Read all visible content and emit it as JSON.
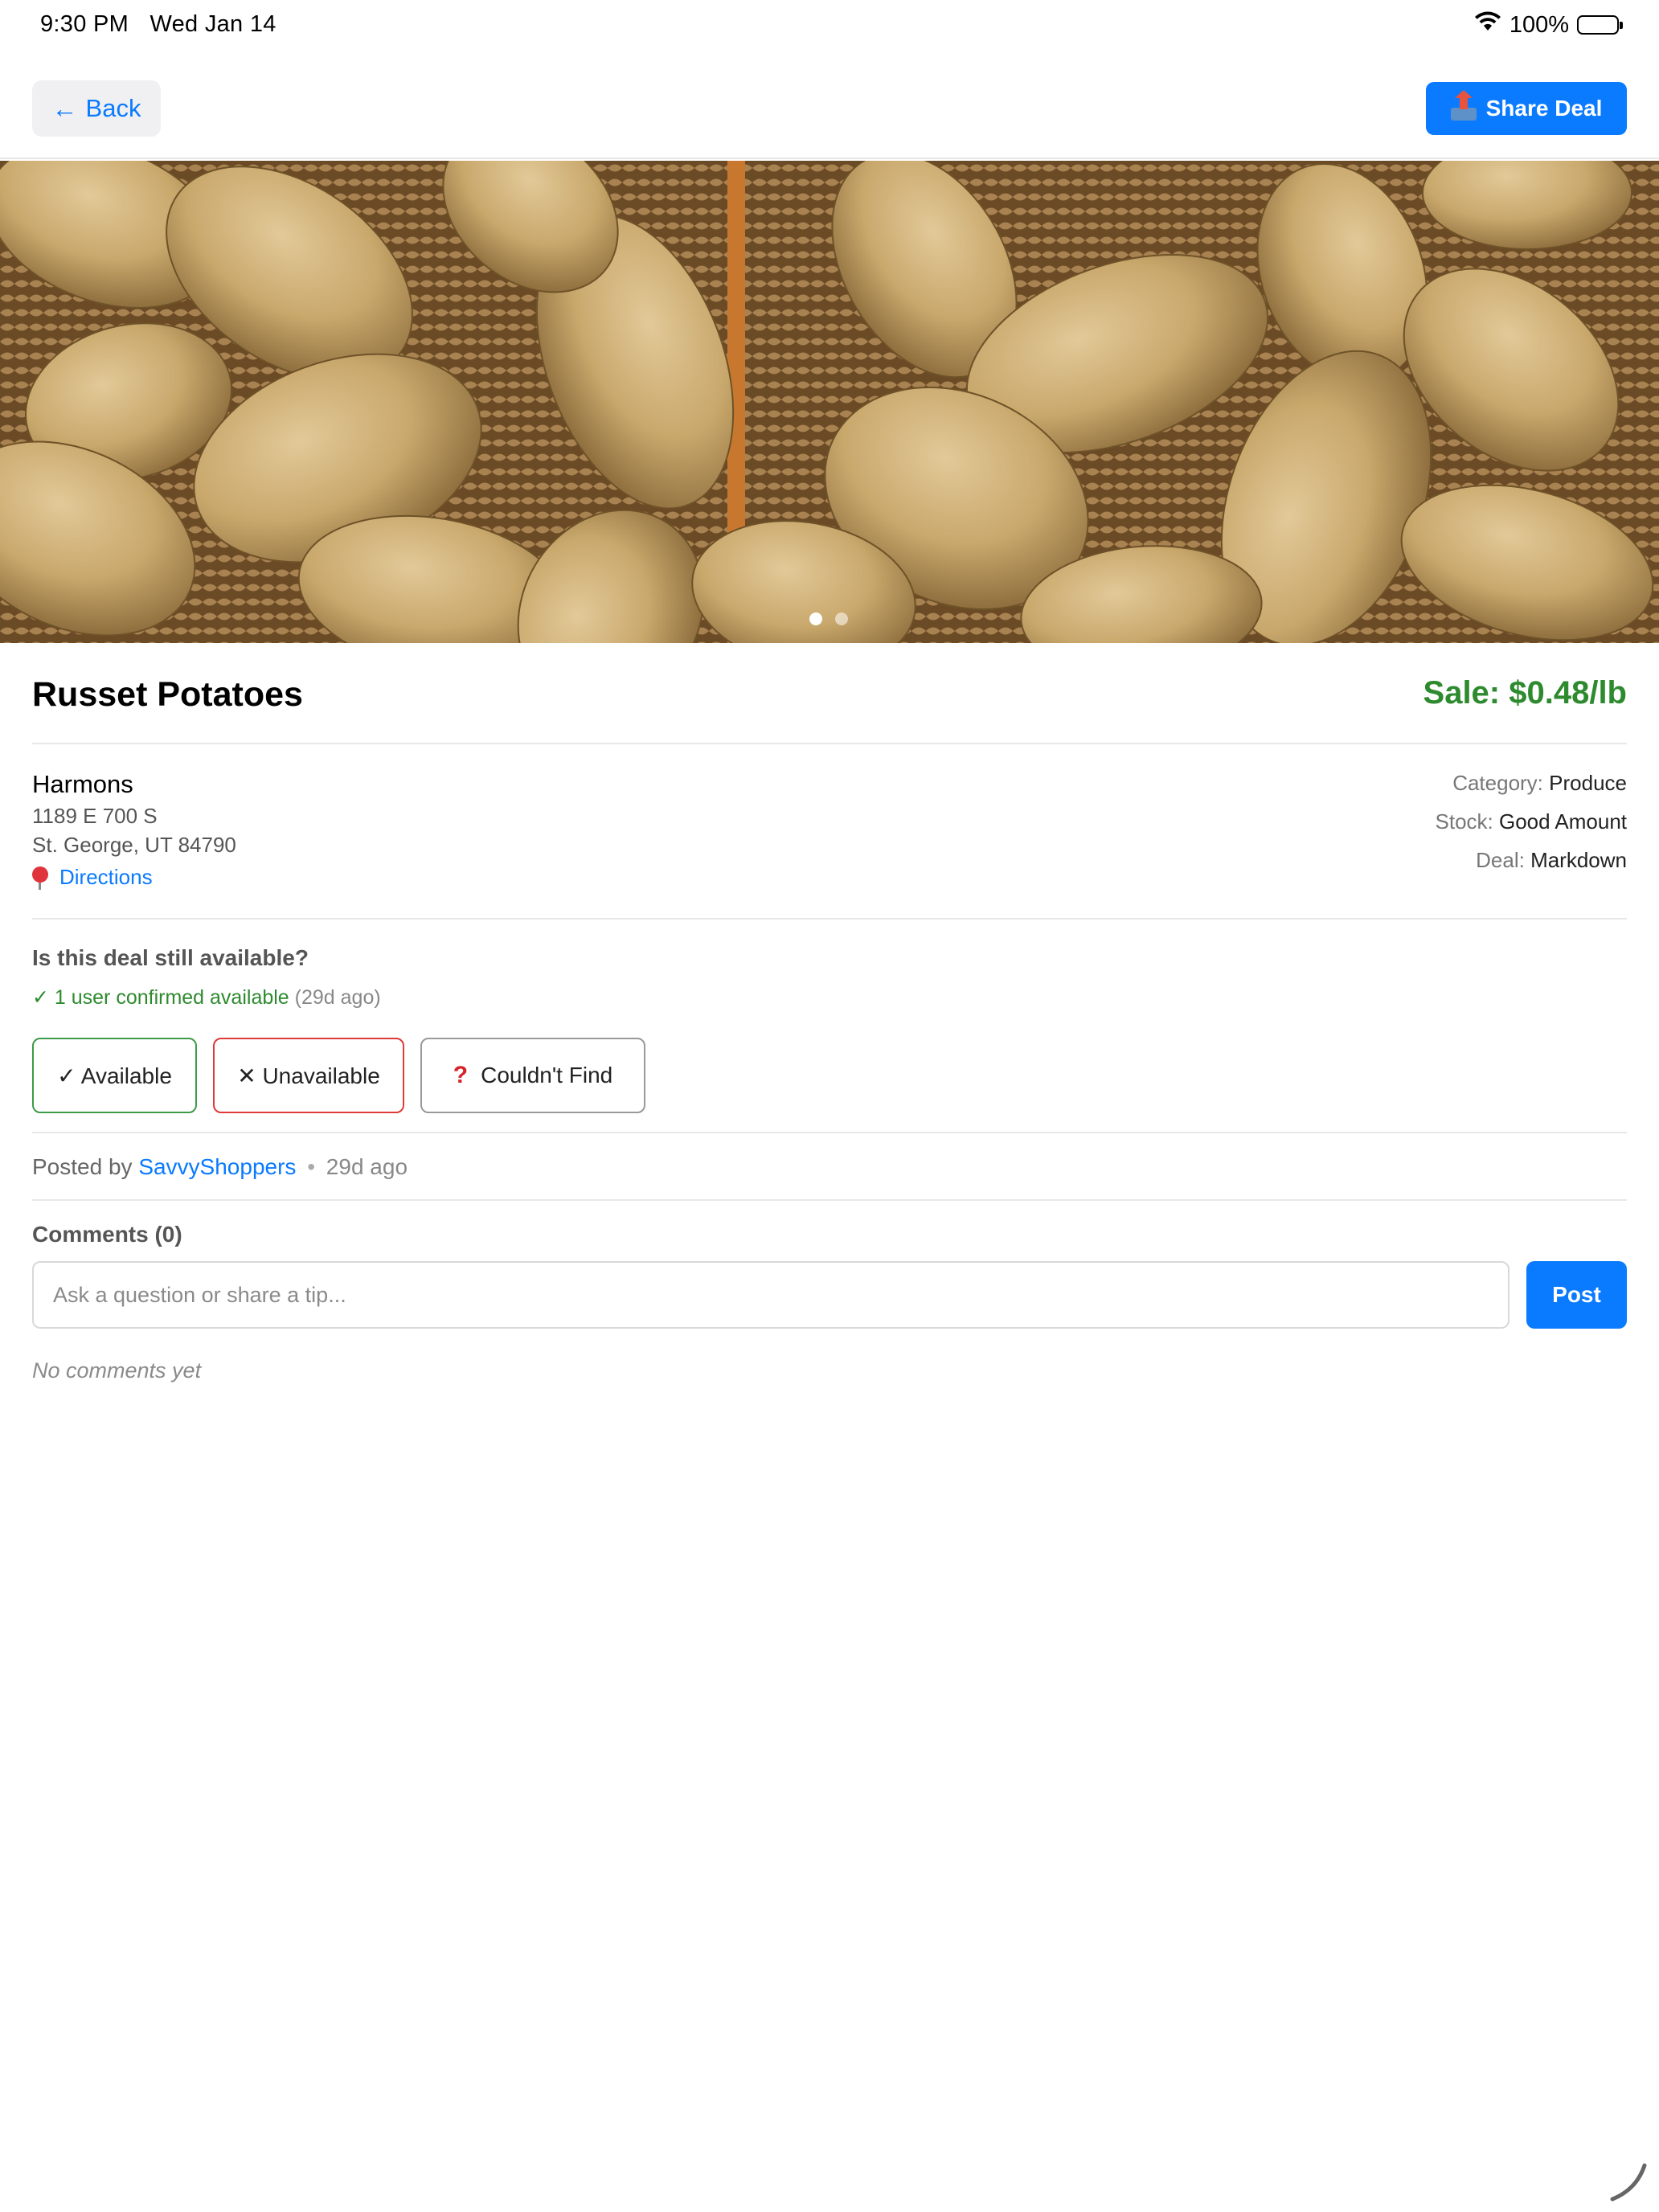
{
  "status_bar": {
    "time": "9:30 PM",
    "date": "Wed Jan 14",
    "battery": "100%",
    "icons": [
      "wifi-icon",
      "battery-icon"
    ]
  },
  "topbar": {
    "back_label": "Back",
    "back_icon": "arrow-left-icon",
    "share_label": "Share Deal",
    "share_icon": "outbox-tray-icon"
  },
  "hero": {
    "image_count": 2,
    "active_index": 0
  },
  "deal": {
    "title": "Russet Potatoes",
    "price": "Sale: $0.48/lb"
  },
  "store": {
    "name": "Harmons",
    "address_line1": "1189 E 700 S",
    "address_line2": "St. George, UT 84790",
    "directions_label": "Directions",
    "directions_icon": "map-pin-icon"
  },
  "meta": {
    "category_label": "Category:",
    "category_value": "Produce",
    "stock_label": "Stock:",
    "stock_value": "Good Amount",
    "deal_label": "Deal:",
    "deal_value": "Markdown"
  },
  "availability": {
    "question": "Is this deal still available?",
    "confirmed_text": "✓ 1 user confirmed available",
    "confirmed_ago": "(29d ago)",
    "available_label": "✓ Available",
    "unavailable_label": "✕ Unavailable",
    "couldnt_find_label": "Couldn't Find",
    "couldnt_find_icon": "question-mark-icon"
  },
  "posted": {
    "prefix": "Posted by",
    "user": "SavvyShoppers",
    "separator": "•",
    "time": "29d ago"
  },
  "comments": {
    "header": "Comments (0)",
    "placeholder": "Ask a question or share a tip...",
    "post_label": "Post",
    "empty_text": "No comments yet"
  },
  "colors": {
    "accent": "#0a7aff",
    "price_green": "#2e8a2e",
    "unavailable_red": "#dd3a3a"
  }
}
